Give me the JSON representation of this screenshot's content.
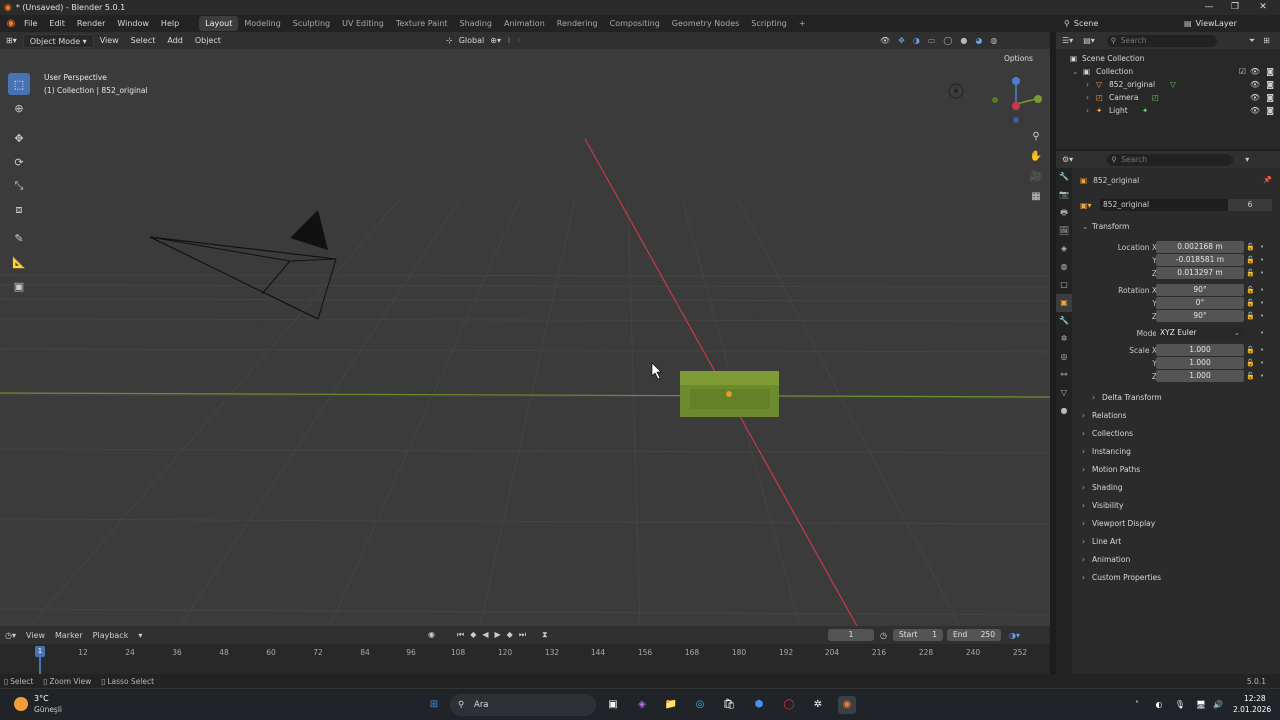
{
  "window": {
    "title": "* (Unsaved) - Blender 5.0.1",
    "minimize": "—",
    "maximize": "❐",
    "close": "✕"
  },
  "menubar": {
    "items": [
      "File",
      "Edit",
      "Render",
      "Window",
      "Help"
    ],
    "workspaces": [
      "Layout",
      "Modeling",
      "Sculpting",
      "UV Editing",
      "Texture Paint",
      "Shading",
      "Animation",
      "Rendering",
      "Compositing",
      "Geometry Nodes",
      "Scripting"
    ],
    "active_workspace": "Layout",
    "add_workspace": "+",
    "scene_label": "Scene",
    "view_layer_label": "ViewLayer"
  },
  "viewport_header": {
    "mode": "Object Mode",
    "menus": [
      "View",
      "Select",
      "Add",
      "Object"
    ],
    "orientation": "Global",
    "options": "Options"
  },
  "viewport": {
    "perspective": "User Perspective",
    "collection_info": "(1) Collection | 852_original"
  },
  "outliner": {
    "search_placeholder": "Search",
    "scene_collection": "Scene Collection",
    "collection": "Collection",
    "objects": [
      "852_original",
      "Camera",
      "Light"
    ]
  },
  "properties": {
    "search_placeholder": "Search",
    "object_name": "852_original",
    "data_name": "852_original",
    "user_count": "6",
    "transform_label": "Transform",
    "location_label": "Location X",
    "location": [
      "0.002168 m",
      "-0.018581 m",
      "0.013297 m"
    ],
    "rotation_label": "Rotation X",
    "rotation": [
      "90°",
      "0°",
      "90°"
    ],
    "mode_label": "Mode",
    "mode_value": "XYZ Euler",
    "scale_label": "Scale X",
    "scale": [
      "1.000",
      "1.000",
      "1.000"
    ],
    "axis_y": "Y",
    "axis_z": "Z",
    "delta_transform": "Delta Transform",
    "sections": [
      "Relations",
      "Collections",
      "Instancing",
      "Motion Paths",
      "Shading",
      "Visibility",
      "Viewport Display",
      "Line Art",
      "Animation",
      "Custom Properties"
    ]
  },
  "timeline": {
    "menus": [
      "View",
      "Marker",
      "Playback"
    ],
    "current_frame": "1",
    "start_label": "Start",
    "start": "1",
    "end_label": "End",
    "end": "250",
    "ticks": [
      "12",
      "24",
      "36",
      "48",
      "60",
      "72",
      "84",
      "96",
      "108",
      "120",
      "132",
      "144",
      "156",
      "168",
      "180",
      "192",
      "204",
      "216",
      "228",
      "240",
      "252"
    ],
    "playhead": "1"
  },
  "statusbar": {
    "items": [
      "Select",
      "Zoom View",
      "Lasso Select"
    ],
    "version": "5.0.1"
  },
  "taskbar": {
    "weather_temp": "3°C",
    "weather_desc": "Güneşli",
    "search": "Ara",
    "time": "12:28",
    "date": "2.01.2026"
  },
  "colors": {
    "accent": "#4772b3",
    "x_axis": "#c8384a",
    "y_axis": "#7a9a32",
    "viewport_bg": "#3b3b3b"
  }
}
